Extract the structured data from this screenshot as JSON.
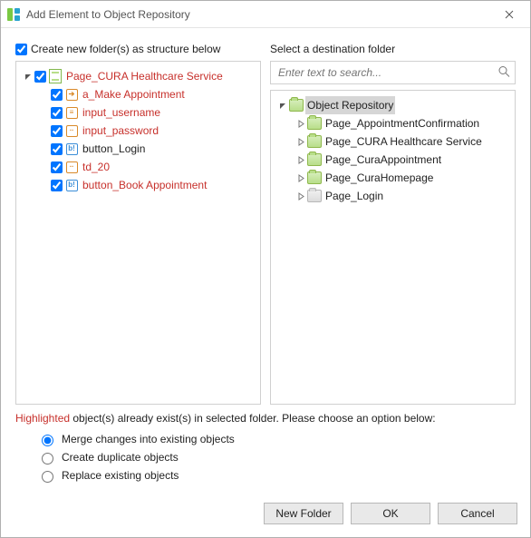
{
  "title": "Add Element to Object Repository",
  "left": {
    "createLabel": "Create new folder(s) as structure below",
    "tree": [
      {
        "id": "page",
        "label": "Page_CURA Healthcare Service",
        "icon": "page",
        "hl": true,
        "checked": true,
        "expander": "down",
        "depth": 0,
        "children": [
          {
            "id": "a_make",
            "label": "a_Make Appointment",
            "icon": "orange-arrow",
            "hl": true,
            "checked": true,
            "depth": 1
          },
          {
            "id": "u",
            "label": "input_username",
            "icon": "orange-lines",
            "hl": true,
            "checked": true,
            "depth": 1
          },
          {
            "id": "p",
            "label": "input_password",
            "icon": "orange-dots",
            "hl": true,
            "checked": true,
            "depth": 1
          },
          {
            "id": "bl",
            "label": "button_Login",
            "icon": "blue-b",
            "hl": false,
            "checked": true,
            "depth": 1
          },
          {
            "id": "td",
            "label": "td_20",
            "icon": "orange-dots",
            "hl": true,
            "checked": true,
            "depth": 1
          },
          {
            "id": "bb",
            "label": "button_Book Appointment",
            "icon": "blue-b",
            "hl": true,
            "checked": true,
            "depth": 1
          }
        ]
      }
    ]
  },
  "right": {
    "destLabel": "Select a destination folder",
    "searchPlaceholder": "Enter text to search...",
    "tree": [
      {
        "id": "repo",
        "label": "Object Repository",
        "icon": "folder",
        "selected": true,
        "expander": "down",
        "depth": 0,
        "children": [
          {
            "id": "p1",
            "label": "Page_AppointmentConfirmation",
            "icon": "folder",
            "expander": "right",
            "depth": 1
          },
          {
            "id": "p2",
            "label": "Page_CURA Healthcare Service",
            "icon": "folder",
            "expander": "right",
            "depth": 1
          },
          {
            "id": "p3",
            "label": "Page_CuraAppointment",
            "icon": "folder",
            "expander": "right",
            "depth": 1
          },
          {
            "id": "p4",
            "label": "Page_CuraHomepage",
            "icon": "folder",
            "expander": "right",
            "depth": 1
          },
          {
            "id": "p5",
            "label": "Page_Login",
            "icon": "folder-grey",
            "expander": "right",
            "depth": 1
          }
        ]
      }
    ]
  },
  "message": {
    "highlighted": "Highlighted",
    "rest": " object(s) already exist(s) in selected folder. Please choose an option below:"
  },
  "options": [
    "Merge changes into existing objects",
    "Create duplicate objects",
    "Replace existing objects"
  ],
  "buttons": {
    "newFolder": "New Folder",
    "ok": "OK",
    "cancel": "Cancel"
  }
}
